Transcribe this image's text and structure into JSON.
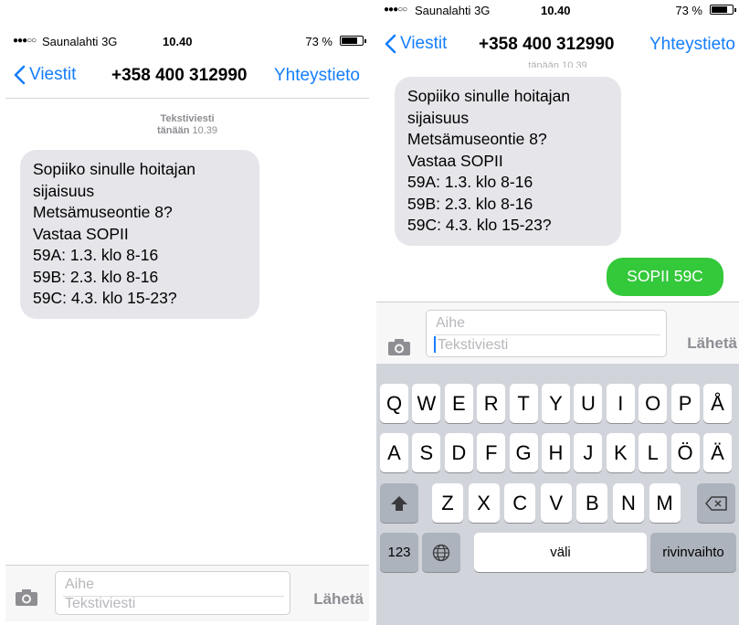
{
  "status": {
    "signal": "●●●○○",
    "carrier": "Saunalahti",
    "network": "3G",
    "time": "10.40",
    "battery": "73 %"
  },
  "nav": {
    "back_label": "Viestit",
    "title": "+358 400 312990",
    "contact_label": "Yhteystieto"
  },
  "conversation": {
    "kind": "Tekstiviesti",
    "date_prefix": "tänään",
    "time": "10.39",
    "peek": "tänään 10.39"
  },
  "incoming_message": "Sopiiko sinulle hoitajan\nsijaisuus\nMetsämuseontie 8?\nVastaa SOPII\n59A: 1.3. klo 8-16\n59B: 2.3. klo 8-16\n59C: 4.3. klo 15-23?",
  "outgoing_message": "SOPII 59C",
  "composer": {
    "subject_placeholder": "Aihe",
    "body_placeholder": "Tekstiviesti",
    "send_label": "Lähetä"
  },
  "keyboard": {
    "row1": [
      "Q",
      "W",
      "E",
      "R",
      "T",
      "Y",
      "U",
      "I",
      "O",
      "P",
      "Å"
    ],
    "row2": [
      "A",
      "S",
      "D",
      "F",
      "G",
      "H",
      "J",
      "K",
      "L",
      "Ö",
      "Ä"
    ],
    "row3": [
      "Z",
      "X",
      "C",
      "V",
      "B",
      "N",
      "M"
    ],
    "numbers_label": "123",
    "space_label": "väli",
    "return_label": "rivinvaihto"
  },
  "icons": {
    "back": "chevron-left-icon",
    "camera": "camera-icon",
    "shift": "shift-icon",
    "backspace": "backspace-icon",
    "globe": "globe-icon"
  },
  "colors": {
    "accent": "#157efb",
    "incoming_bubble": "#e5e5ea",
    "outgoing_bubble": "#34c83b",
    "keyboard_bg": "#d1d5db"
  }
}
